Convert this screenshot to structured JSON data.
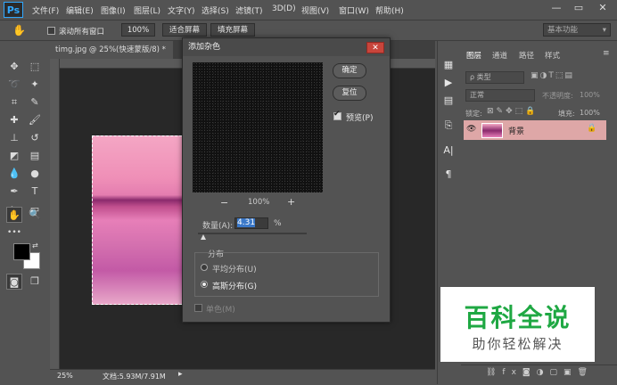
{
  "app": {
    "logo": "Ps"
  },
  "menu": [
    "文件(F)",
    "编辑(E)",
    "图像(I)",
    "图层(L)",
    "文字(Y)",
    "选择(S)",
    "滤镜(T)",
    "3D(D)",
    "视图(V)",
    "窗口(W)",
    "帮助(H)"
  ],
  "window_controls": {
    "minimize": "—",
    "restore": "▭",
    "close": "✕"
  },
  "options": {
    "scroll_all_windows": "滚动所有窗口",
    "zoom": "100%",
    "fit_screen": "适合屏幕",
    "fill_screen": "填充屏幕",
    "workspace": "基本功能"
  },
  "document": {
    "tab_title": "timg.jpg @ 25%(快速蒙版/8) *",
    "tab_close": "×",
    "zoom": "25%",
    "doc_size": "文档:5.93M/7.91M"
  },
  "dialog": {
    "title": "添加杂色",
    "close": "✕",
    "ok": "确定",
    "reset": "复位",
    "preview_label": "预览(P)",
    "preview_checked": true,
    "zoom_out": "−",
    "zoom_level": "100%",
    "zoom_in": "+",
    "amount_label": "数量(A):",
    "amount_value": "4.31",
    "amount_unit": "%",
    "amount_percent": 4.31,
    "distribution_label": "分布",
    "uniform": "平均分布(U)",
    "gaussian": "高斯分布(G)",
    "selected_distribution": "gaussian",
    "monochrome": "单色(M)",
    "monochrome_checked": false
  },
  "panels": {
    "tabs": [
      "图层",
      "通道",
      "路径",
      "样式"
    ],
    "active_tab": "图层",
    "kind_filter": "ρ 类型",
    "blend_mode": "正常",
    "opacity_label": "不透明度:",
    "opacity_value": "100%",
    "lock_label": "锁定:",
    "fill_label": "填充:",
    "fill_value": "100%",
    "layers": [
      {
        "name": "背景",
        "visible": true,
        "locked": true
      }
    ]
  },
  "watermark": {
    "title": "百科全说",
    "subtitle": "助你轻松解决"
  },
  "colors": {
    "accent_selection": "#3a78c8",
    "layer_highlight": "#dea7a7",
    "close_red": "#c8453b",
    "watermark_green": "#1fa843"
  }
}
